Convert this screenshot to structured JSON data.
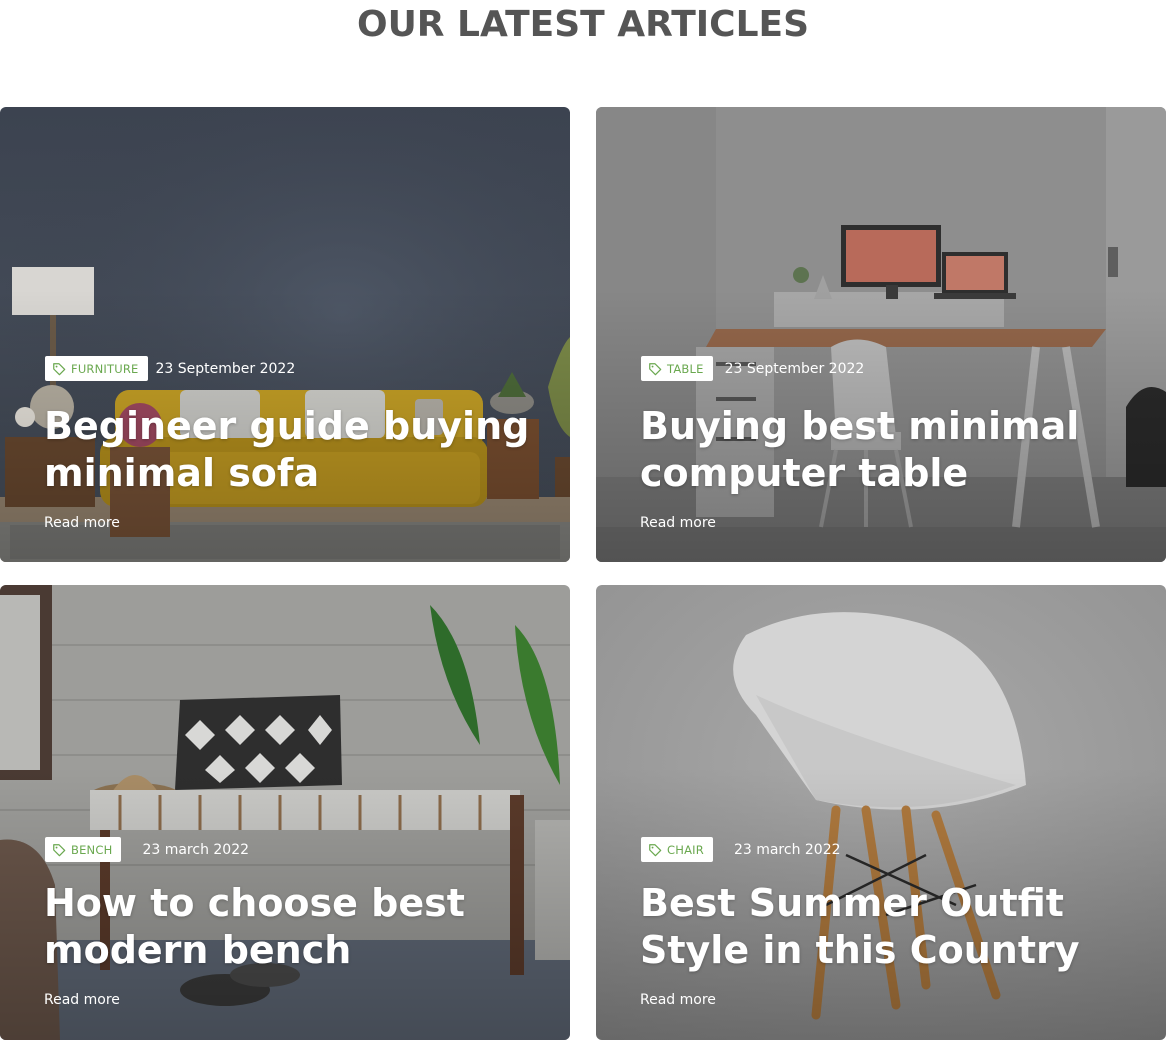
{
  "page": {
    "title": "OUR LATEST ARTICLES"
  },
  "colors": {
    "tag_text": "#6aa84f",
    "heading": "#555555"
  },
  "articles": [
    {
      "tag": "FURNITURE",
      "tag_icon": "tag-icon",
      "date": "23 September 2022",
      "title": "Begineer guide buying minimal sofa",
      "read_more": "Read more",
      "image": "living-room-yellow-sofa"
    },
    {
      "tag": "TABLE",
      "tag_icon": "tag-icon",
      "date": "23 September 2022",
      "title": "Buying best minimal computer table",
      "read_more": "Read more",
      "image": "desk-with-monitor-and-laptop"
    },
    {
      "tag": "BENCH",
      "tag_icon": "tag-icon",
      "date": "23 march 2022",
      "title": "How to choose best modern bench",
      "read_more": "Read more",
      "image": "woven-bench-with-plant"
    },
    {
      "tag": "CHAIR",
      "tag_icon": "tag-icon",
      "date": "23 march 2022",
      "title": "Best Summer Outfit Style in this Country",
      "read_more": "Read more",
      "image": "white-shell-chair"
    }
  ]
}
